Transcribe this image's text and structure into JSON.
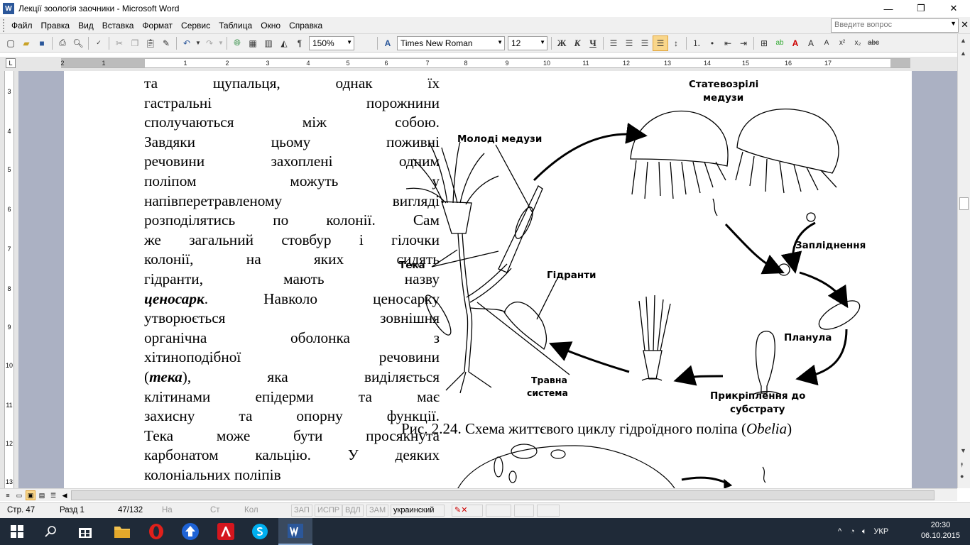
{
  "window": {
    "title": "Лекції зоологія заочники - Microsoft Word",
    "app_icon_letter": "W",
    "minimize_glyph": "—",
    "maximize_glyph": "❐",
    "close_glyph": "✕"
  },
  "menu": {
    "items": [
      "Файл",
      "Правка",
      "Вид",
      "Вставка",
      "Формат",
      "Сервис",
      "Таблица",
      "Окно",
      "Справка"
    ],
    "ask_placeholder": "Введите вопрос",
    "close_glyph": "✕"
  },
  "toolbar": {
    "zoom": "150%",
    "font_name": "Times New Roman",
    "font_size": "12",
    "bold_label": "Ж",
    "italic_label": "К",
    "underline_label": "Ч",
    "paragraph_mark": "¶"
  },
  "ruler": {
    "h_numbers": [
      "2",
      "1",
      "1",
      "2",
      "3",
      "4",
      "5",
      "6",
      "7",
      "8",
      "9",
      "10",
      "11",
      "12",
      "13",
      "14",
      "15",
      "16",
      "17"
    ],
    "v_numbers": [
      "3",
      "4",
      "5",
      "6",
      "7",
      "8",
      "9",
      "10",
      "11",
      "12",
      "13"
    ],
    "corner_label": "L"
  },
  "document": {
    "lines": [
      "та щупальця, однак їх",
      "гастральні порожнини",
      "сполучаються між собою.",
      "Завдяки цьому поживні",
      "речовини захоплені одним",
      "поліпом можуть у",
      "напівперетравленому вигляді",
      "розподілятись по колонії. Сам",
      "же загальний стовбур і гілочки",
      "колонії, на яких сидять",
      "гідранти, мають назву"
    ],
    "line_12_bold_italic": "ценосарк",
    "line_12_rest": ". Навколо ценосарку",
    "lines_after": [
      "утворюється зовнішня",
      "органічна оболонка з",
      "хітиноподібної речовини"
    ],
    "line_16_open": "(",
    "line_16_bold_italic": "тека",
    "line_16_rest": "), яка виділяється",
    "lines_end": [
      "клітинами епідерми та має",
      "захисну та опорну функції.",
      "Тека може бути просякнута",
      "карбонатом кальцію. У деяких",
      "колоніальних поліпів"
    ],
    "figure_labels": {
      "young_medusae": "Молоді медузи",
      "mature_medusae_1": "Статевозрілі",
      "mature_medusae_2": "медузи",
      "fertilization": "Запліднення",
      "theca": "Тека",
      "hydranths": "Гідранти",
      "planula": "Планула",
      "digestive_1": "Травна",
      "digestive_2": "система",
      "attachment_1": "Прикріплення до",
      "attachment_2": "субстрату"
    },
    "caption_main": "Рис. 2.24. Схема життєвого циклу гідроїдного поліпа (",
    "caption_italic": "Obelia",
    "caption_close": ")"
  },
  "statusbar": {
    "page": "Стр. 47",
    "section": "Разд 1",
    "page_of": "47/132",
    "at": "На",
    "line": "Ст",
    "col": "Кол",
    "rec": "ЗАП",
    "trk": "ИСПР",
    "ext": "ВДЛ",
    "ovr": "ЗАМ",
    "language": "украинский"
  },
  "taskbar": {
    "language": "УКР",
    "time": "20:30",
    "date": "06.10.2015"
  }
}
